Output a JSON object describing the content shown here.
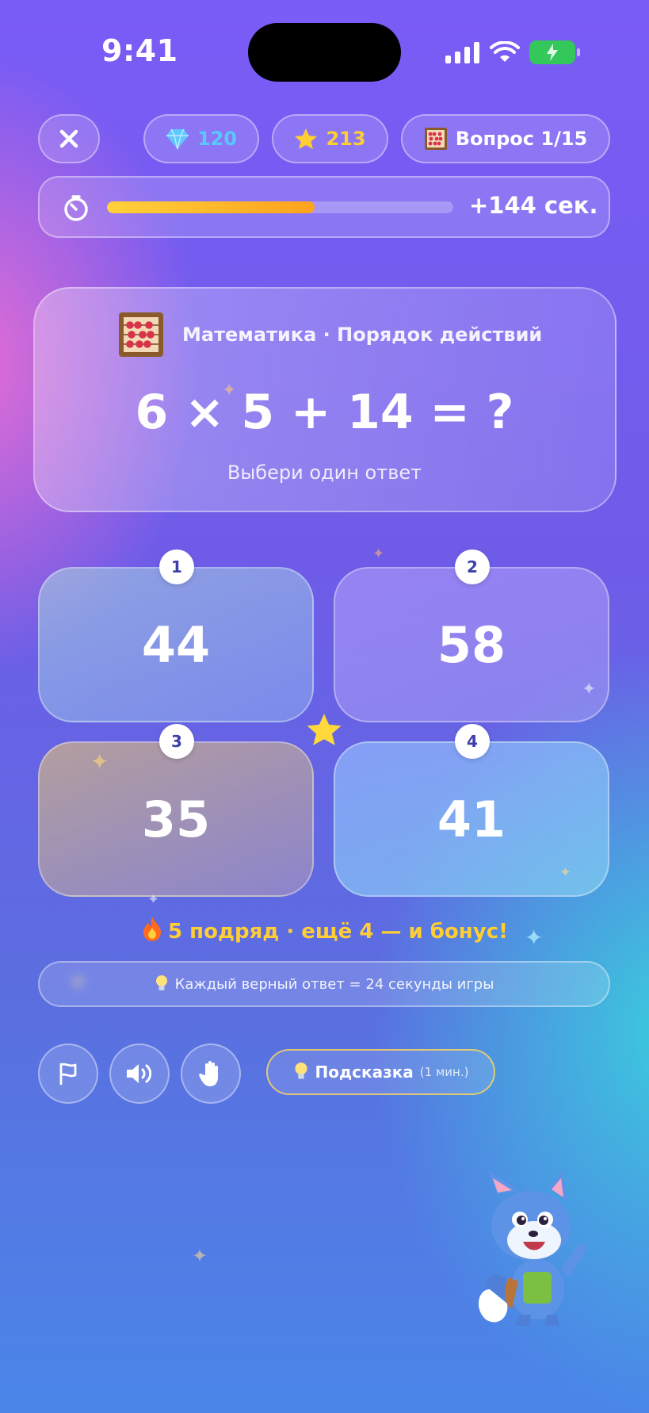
{
  "status_bar": {
    "time": "9:41"
  },
  "header": {
    "close_icon": "close-icon",
    "gems": {
      "icon": "gem-icon",
      "value": "120"
    },
    "stars": {
      "icon": "star-icon",
      "value": "213"
    },
    "question": {
      "icon": "abacus-icon",
      "label": "Вопрос 1/15"
    }
  },
  "timer": {
    "icon": "timer-icon",
    "progress": 0.6,
    "bonus_text": "+144 сек."
  },
  "question_card": {
    "subject_icon": "abacus-icon",
    "subject": "Математика · Порядок действий",
    "equation": "6 × 5 + 14 = ?",
    "instruction": "Выбери один ответ"
  },
  "answers": [
    {
      "number": "1",
      "value": "44"
    },
    {
      "number": "2",
      "value": "58"
    },
    {
      "number": "3",
      "value": "35"
    },
    {
      "number": "4",
      "value": "41"
    }
  ],
  "streak": {
    "icon": "fire-icon",
    "text": "5 подряд · ещё 4 — и бонус!"
  },
  "tip": {
    "icon": "lightbulb-icon",
    "text": "Каждый верный ответ = 24 секунды игры"
  },
  "toolbar": {
    "report_icon": "flag-icon",
    "sound_icon": "speaker-icon",
    "hand_icon": "hand-icon",
    "hint": {
      "icon": "lightbulb-icon",
      "label": "Подсказка",
      "cost": "(1 мин.)"
    }
  },
  "mascot": "fox-mascot",
  "colors": {
    "gold": "#ffcd34",
    "gem_blue": "#59c8ff",
    "progress": "#ffa21d",
    "badge_text": "#3d3fa8"
  }
}
